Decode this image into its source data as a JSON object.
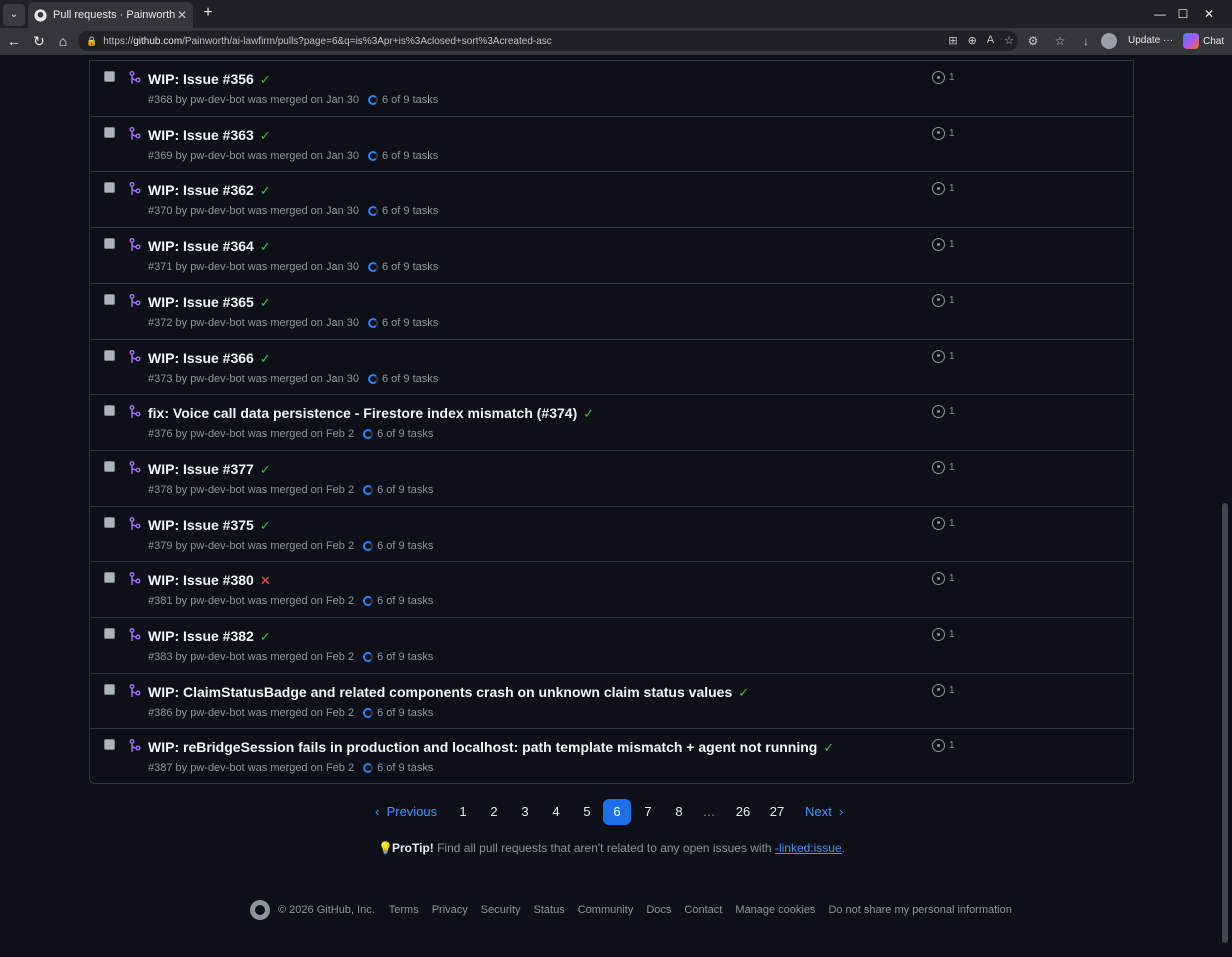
{
  "browser": {
    "tab_title": "Pull requests · Painworth/ai-lawfirm",
    "url_host": "github.com",
    "url_path": "/Painworth/ai-lawfirm/pulls?page=6&q=is%3Apr+is%3Aclosed+sort%3Acreated-asc",
    "url_scheme": "https://",
    "update_label": "Update",
    "update_more": "···",
    "chat_label": "Chat"
  },
  "pulls": [
    {
      "title": "WIP: Issue #356",
      "status": "success",
      "number": "#368",
      "author": "pw-dev-bot",
      "state_text": "was merged on Jan 30",
      "tasks": "6 of 9 tasks",
      "linked": "1"
    },
    {
      "title": "WIP: Issue #363",
      "status": "success",
      "number": "#369",
      "author": "pw-dev-bot",
      "state_text": "was merged on Jan 30",
      "tasks": "6 of 9 tasks",
      "linked": "1"
    },
    {
      "title": "WIP: Issue #362",
      "status": "success",
      "number": "#370",
      "author": "pw-dev-bot",
      "state_text": "was merged on Jan 30",
      "tasks": "6 of 9 tasks",
      "linked": "1"
    },
    {
      "title": "WIP: Issue #364",
      "status": "success",
      "number": "#371",
      "author": "pw-dev-bot",
      "state_text": "was merged on Jan 30",
      "tasks": "6 of 9 tasks",
      "linked": "1"
    },
    {
      "title": "WIP: Issue #365",
      "status": "success",
      "number": "#372",
      "author": "pw-dev-bot",
      "state_text": "was merged on Jan 30",
      "tasks": "6 of 9 tasks",
      "linked": "1"
    },
    {
      "title": "WIP: Issue #366",
      "status": "success",
      "number": "#373",
      "author": "pw-dev-bot",
      "state_text": "was merged on Jan 30",
      "tasks": "6 of 9 tasks",
      "linked": "1"
    },
    {
      "title": "fix: Voice call data persistence - Firestore index mismatch (#374)",
      "status": "success",
      "number": "#376",
      "author": "pw-dev-bot",
      "state_text": "was merged on Feb 2",
      "tasks": "6 of 9 tasks",
      "linked": "1"
    },
    {
      "title": "WIP: Issue #377",
      "status": "success",
      "number": "#378",
      "author": "pw-dev-bot",
      "state_text": "was merged on Feb 2",
      "tasks": "6 of 9 tasks",
      "linked": "1"
    },
    {
      "title": "WIP: Issue #375",
      "status": "success",
      "number": "#379",
      "author": "pw-dev-bot",
      "state_text": "was merged on Feb 2",
      "tasks": "6 of 9 tasks",
      "linked": "1"
    },
    {
      "title": "WIP: Issue #380",
      "status": "failure",
      "number": "#381",
      "author": "pw-dev-bot",
      "state_text": "was merged on Feb 2",
      "tasks": "6 of 9 tasks",
      "linked": "1"
    },
    {
      "title": "WIP: Issue #382",
      "status": "success",
      "number": "#383",
      "author": "pw-dev-bot",
      "state_text": "was merged on Feb 2",
      "tasks": "6 of 9 tasks",
      "linked": "1"
    },
    {
      "title": "WIP: ClaimStatusBadge and related components crash on unknown claim status values",
      "status": "success",
      "number": "#386",
      "author": "pw-dev-bot",
      "state_text": "was merged on Feb 2",
      "tasks": "6 of 9 tasks",
      "linked": "1"
    },
    {
      "title": "WIP: reBridgeSession fails in production and localhost: path template mismatch + agent not running",
      "status": "success",
      "number": "#387",
      "author": "pw-dev-bot",
      "state_text": "was merged on Feb 2",
      "tasks": "6 of 9 tasks",
      "linked": "1"
    }
  ],
  "pagination": {
    "previous": "Previous",
    "next": "Next",
    "pages": [
      "1",
      "2",
      "3",
      "4",
      "5",
      "6",
      "7",
      "8",
      "…",
      "26",
      "27"
    ],
    "current": "6"
  },
  "protip": {
    "label": "ProTip!",
    "text": "Find all pull requests that aren't related to any open issues with",
    "link": "-linked:issue",
    "end": "."
  },
  "footer": {
    "copyright": "© 2026 GitHub, Inc.",
    "links": [
      "Terms",
      "Privacy",
      "Security",
      "Status",
      "Community",
      "Docs",
      "Contact",
      "Manage cookies",
      "Do not share my personal information"
    ]
  },
  "colors": {
    "background": "#0d1117",
    "success": "#3fb950",
    "failure": "#f85149",
    "merged": "#a371f7",
    "link": "#4493f8",
    "current_page": "#1f6feb"
  }
}
